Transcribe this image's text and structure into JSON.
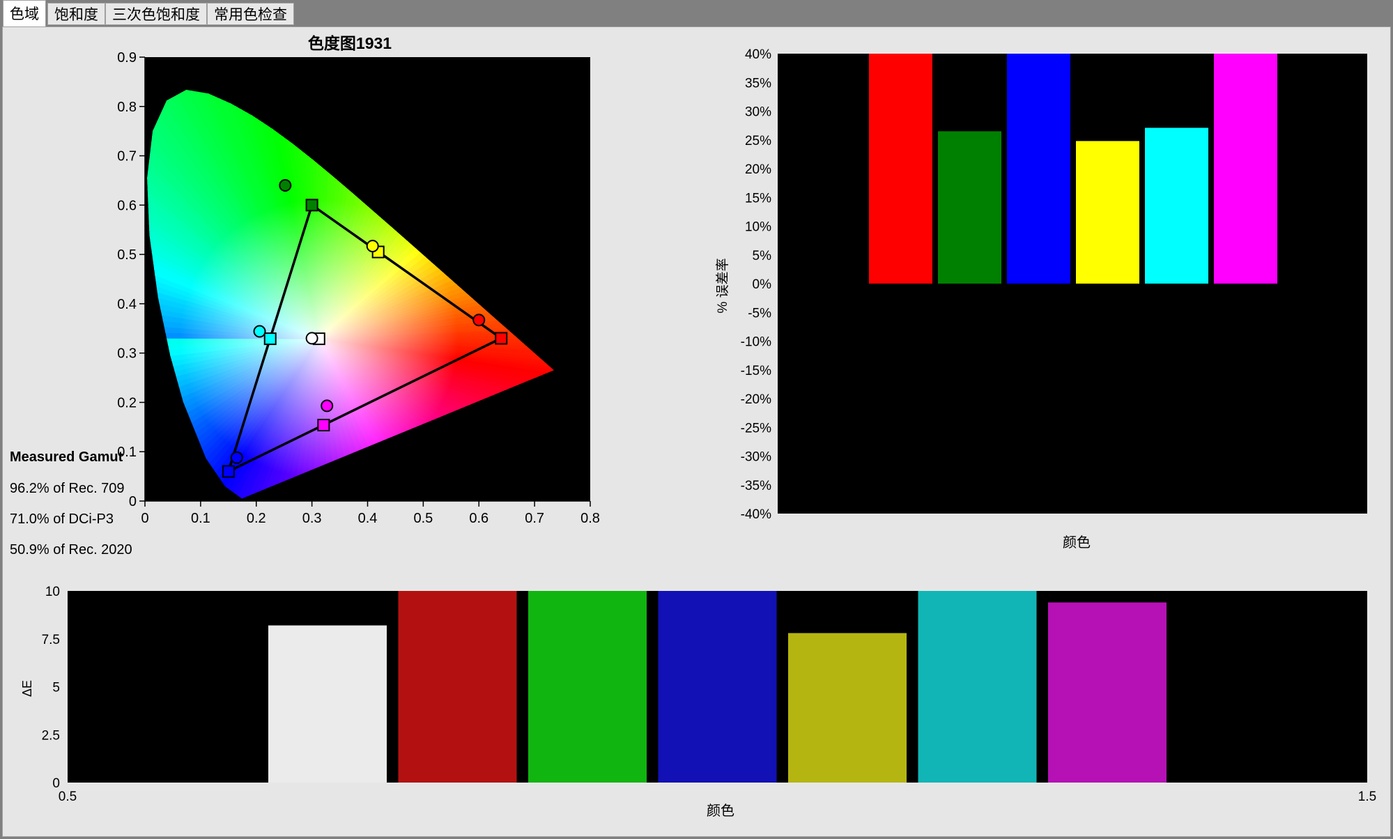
{
  "tabs": [
    {
      "label": "色域",
      "active": true
    },
    {
      "label": "饱和度",
      "active": false
    },
    {
      "label": "三次色饱和度",
      "active": false
    },
    {
      "label": "常用色检查",
      "active": false
    }
  ],
  "gamut_summary": {
    "title": "Measured Gamut",
    "lines": [
      "96.2% of Rec. 709",
      "71.0% of DCi-P3",
      "50.9% of Rec. 2020"
    ]
  },
  "chart_data": [
    {
      "type": "scatter",
      "title": "色度图1931",
      "xlim": [
        0,
        0.8
      ],
      "ylim": [
        0,
        0.9
      ],
      "xticks": [
        "0",
        "0.1",
        "0.2",
        "0.3",
        "0.4",
        "0.5",
        "0.6",
        "0.7",
        "0.8"
      ],
      "yticks": [
        "0",
        "0.1",
        "0.2",
        "0.3",
        "0.4",
        "0.5",
        "0.6",
        "0.7",
        "0.8",
        "0.9"
      ],
      "background": "#000000",
      "reference": [
        {
          "color": "red",
          "x": 0.64,
          "y": 0.33,
          "fill": "#ff0000"
        },
        {
          "color": "green",
          "x": 0.3,
          "y": 0.6,
          "fill": "#008000"
        },
        {
          "color": "blue",
          "x": 0.15,
          "y": 0.06,
          "fill": "#0000ff"
        },
        {
          "color": "yellow",
          "x": 0.419,
          "y": 0.505,
          "fill": "#ffff00"
        },
        {
          "color": "cyan",
          "x": 0.225,
          "y": 0.329,
          "fill": "#00ffff"
        },
        {
          "color": "magenta",
          "x": 0.321,
          "y": 0.154,
          "fill": "#ff00ff"
        },
        {
          "color": "white",
          "x": 0.3127,
          "y": 0.329,
          "fill": "#ffffff"
        }
      ],
      "measured": [
        {
          "color": "red",
          "x": 0.6,
          "y": 0.367,
          "fill": "#ff0000"
        },
        {
          "color": "green",
          "x": 0.252,
          "y": 0.64,
          "fill": "#008000"
        },
        {
          "color": "blue",
          "x": 0.165,
          "y": 0.088,
          "fill": "#0000ff"
        },
        {
          "color": "yellow",
          "x": 0.409,
          "y": 0.517,
          "fill": "#ffff00"
        },
        {
          "color": "cyan",
          "x": 0.206,
          "y": 0.344,
          "fill": "#00ffff"
        },
        {
          "color": "magenta",
          "x": 0.327,
          "y": 0.193,
          "fill": "#ff00ff"
        },
        {
          "color": "white",
          "x": 0.3,
          "y": 0.33,
          "fill": "#ffffff"
        }
      ]
    },
    {
      "type": "bar",
      "title": "",
      "xlabel": "颜色",
      "ylabel": "% 误差率",
      "ylim": [
        -40,
        40
      ],
      "yticks": [
        "40%",
        "35%",
        "30%",
        "25%",
        "20%",
        "15%",
        "10%",
        "5%",
        "0%",
        "-5%",
        "-10%",
        "-15%",
        "-20%",
        "-25%",
        "-30%",
        "-35%",
        "-40%"
      ],
      "background": "#000000",
      "categories": [
        "",
        "",
        "",
        "",
        "",
        ""
      ],
      "values": [
        40,
        26.5,
        40,
        24.8,
        27.1,
        40
      ],
      "colors": [
        "#ff0000",
        "#008000",
        "#0000ff",
        "#ffff00",
        "#00ffff",
        "#ff00ff"
      ]
    },
    {
      "type": "bar",
      "title": "",
      "xlabel": "颜色",
      "ylabel": "ΔE",
      "ylim": [
        0,
        10
      ],
      "yticks": [
        "10",
        "7.5",
        "5",
        "2.5",
        "0"
      ],
      "xticks": [
        "0.5",
        "1.5"
      ],
      "background": "#000000",
      "categories": [
        "",
        "",
        "",
        "",
        "",
        "",
        ""
      ],
      "values": [
        8.2,
        10,
        10,
        10,
        7.8,
        10,
        9.4
      ],
      "colors": [
        "#ebebeb",
        "#b31111",
        "#10b510",
        "#1111b5",
        "#b5b511",
        "#11b5b5",
        "#b511b5"
      ]
    }
  ]
}
